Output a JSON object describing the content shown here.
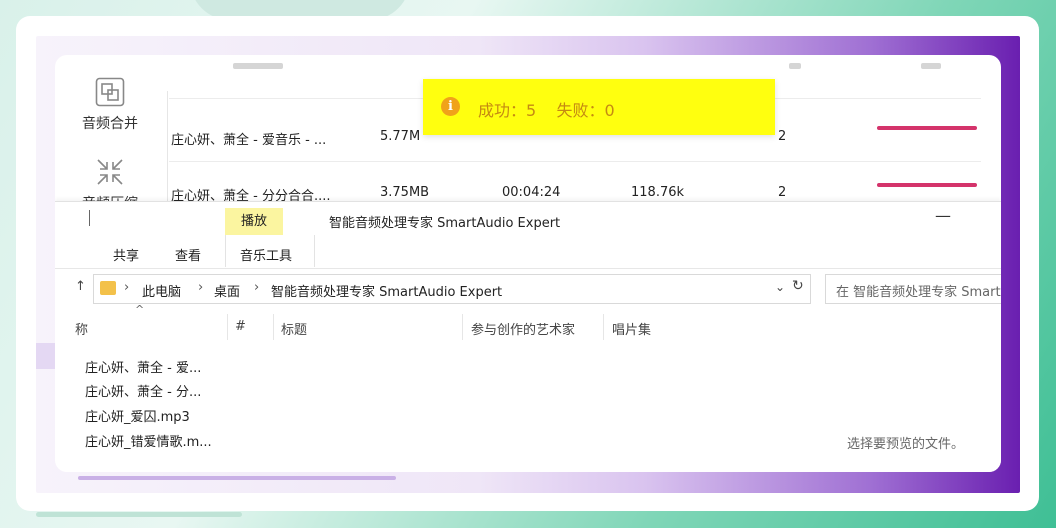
{
  "toast": {
    "message": "成功：5    失败：0"
  },
  "sidebar": {
    "items": [
      {
        "label": "音频合并",
        "icon": "merge-icon"
      },
      {
        "label": "音频压缩",
        "icon": "compress-icon"
      }
    ]
  },
  "table": {
    "rows": [
      {
        "name": "庄心妍、萧全 - 爱音乐 - ...",
        "size": "5.77M",
        "duration": "",
        "bitrate": "",
        "channels": "2"
      },
      {
        "name": "庄心妍、萧全 - 分分合合....",
        "size": "3.75MB",
        "duration": "00:04:24",
        "bitrate": "118.76k",
        "channels": "2"
      }
    ],
    "accent_color": "#d4336b"
  },
  "explorer": {
    "play_tab": "播放",
    "title": "智能音频处理专家 SmartAudio Expert",
    "minimize": "—",
    "ribbon_tabs": [
      "共享",
      "查看",
      "音乐工具"
    ],
    "breadcrumbs": [
      "此电脑",
      "桌面",
      "智能音频处理专家 SmartAudio Expert"
    ],
    "search_placeholder": "在 智能音频处理专家 SmartAudio Expert 中搜索",
    "columns": [
      "称",
      "#",
      "标题",
      "参与创作的艺术家",
      "唱片集"
    ],
    "files": [
      "庄心妍、萧全 - 爱...",
      "庄心妍、萧全 - 分...",
      "庄心妍_爱囚.mp3",
      "庄心妍_错爱情歌.m..."
    ],
    "preview_hint": "选择要预览的文件。"
  }
}
